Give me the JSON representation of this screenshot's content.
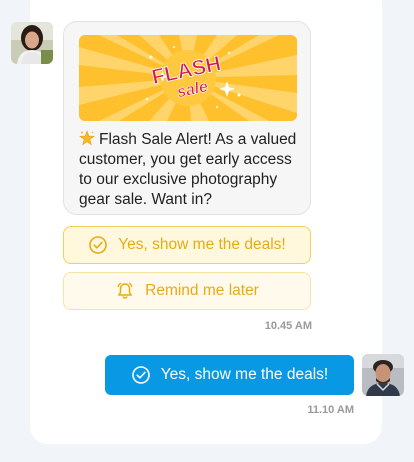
{
  "chat": {
    "incoming": {
      "avatar_icon": "woman-avatar",
      "banner": {
        "line1": "FLASH",
        "line2": "sale",
        "background": "#ffc02e",
        "text_color": "#d6194d"
      },
      "message_icon": "sparkle-star-icon",
      "message": "Flash Sale Alert! As a valued customer, you get early access to our exclusive photography gear sale. Want in?",
      "quick_replies": [
        {
          "icon": "check-circle-icon",
          "label": "Yes, show me the deals!"
        },
        {
          "icon": "bell-icon",
          "label": "Remind me later"
        }
      ],
      "timestamp": "10.45 AM"
    },
    "outgoing": {
      "avatar_icon": "man-avatar",
      "icon": "check-circle-icon",
      "message": "Yes, show me the deals!",
      "timestamp": "11.10 AM",
      "bubble_color": "#0998e4"
    },
    "accent_color": "#e7ab15"
  }
}
